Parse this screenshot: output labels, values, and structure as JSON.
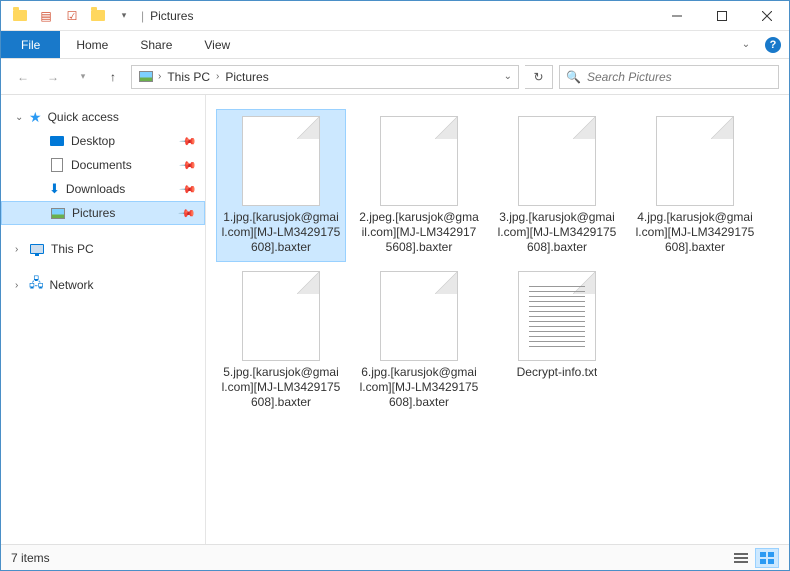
{
  "title": "Pictures",
  "ribbon": {
    "file": "File",
    "home": "Home",
    "share": "Share",
    "view": "View"
  },
  "breadcrumb": {
    "root": "This PC",
    "folder": "Pictures"
  },
  "search": {
    "placeholder": "Search Pictures"
  },
  "sidebar": {
    "quick_access": "Quick access",
    "desktop": "Desktop",
    "documents": "Documents",
    "downloads": "Downloads",
    "pictures": "Pictures",
    "this_pc": "This PC",
    "network": "Network"
  },
  "files": [
    {
      "name": "1.jpg.[karusjok@gmail.com][MJ-LM3429175608].baxter",
      "type": "file",
      "selected": true
    },
    {
      "name": "2.jpeg.[karusjok@gmail.com][MJ-LM3429175608].baxter",
      "type": "file",
      "selected": false
    },
    {
      "name": "3.jpg.[karusjok@gmail.com][MJ-LM3429175608].baxter",
      "type": "file",
      "selected": false
    },
    {
      "name": "4.jpg.[karusjok@gmail.com][MJ-LM3429175608].baxter",
      "type": "file",
      "selected": false
    },
    {
      "name": "5.jpg.[karusjok@gmail.com][MJ-LM3429175608].baxter",
      "type": "file",
      "selected": false
    },
    {
      "name": "6.jpg.[karusjok@gmail.com][MJ-LM3429175608].baxter",
      "type": "file",
      "selected": false
    },
    {
      "name": "Decrypt-info.txt",
      "type": "txt",
      "selected": false
    }
  ],
  "status": {
    "count_label": "7 items"
  },
  "colors": {
    "accent": "#1979ca",
    "selection": "#cce8ff",
    "selection_border": "#99d1ff"
  }
}
